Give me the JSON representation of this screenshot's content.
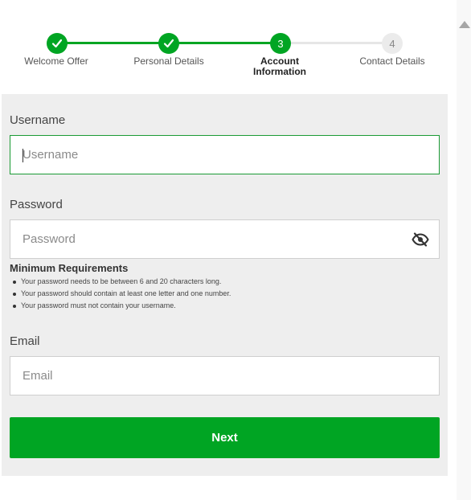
{
  "stepper": {
    "steps": [
      {
        "label": "Welcome Offer",
        "state": "done"
      },
      {
        "label": "Personal Details",
        "state": "done"
      },
      {
        "label": "Account Information",
        "label_line1": "Account",
        "label_line2": "Information",
        "number": "3",
        "state": "active"
      },
      {
        "label": "Contact Details",
        "number": "4",
        "state": "pending"
      }
    ]
  },
  "form": {
    "username": {
      "label": "Username",
      "placeholder": "Username",
      "value": ""
    },
    "password": {
      "label": "Password",
      "placeholder": "Password",
      "value": ""
    },
    "requirements": {
      "title": "Minimum Requirements",
      "items": [
        "Your password needs to be between 6 and 20 characters long.",
        "Your password should contain at least one letter and one number.",
        "Your password must not contain your username."
      ]
    },
    "email": {
      "label": "Email",
      "placeholder": "Email",
      "value": ""
    },
    "next_label": "Next"
  },
  "colors": {
    "accent": "#00a523",
    "panel_bg": "#eeeeee",
    "focus_border": "#1b9a35"
  }
}
